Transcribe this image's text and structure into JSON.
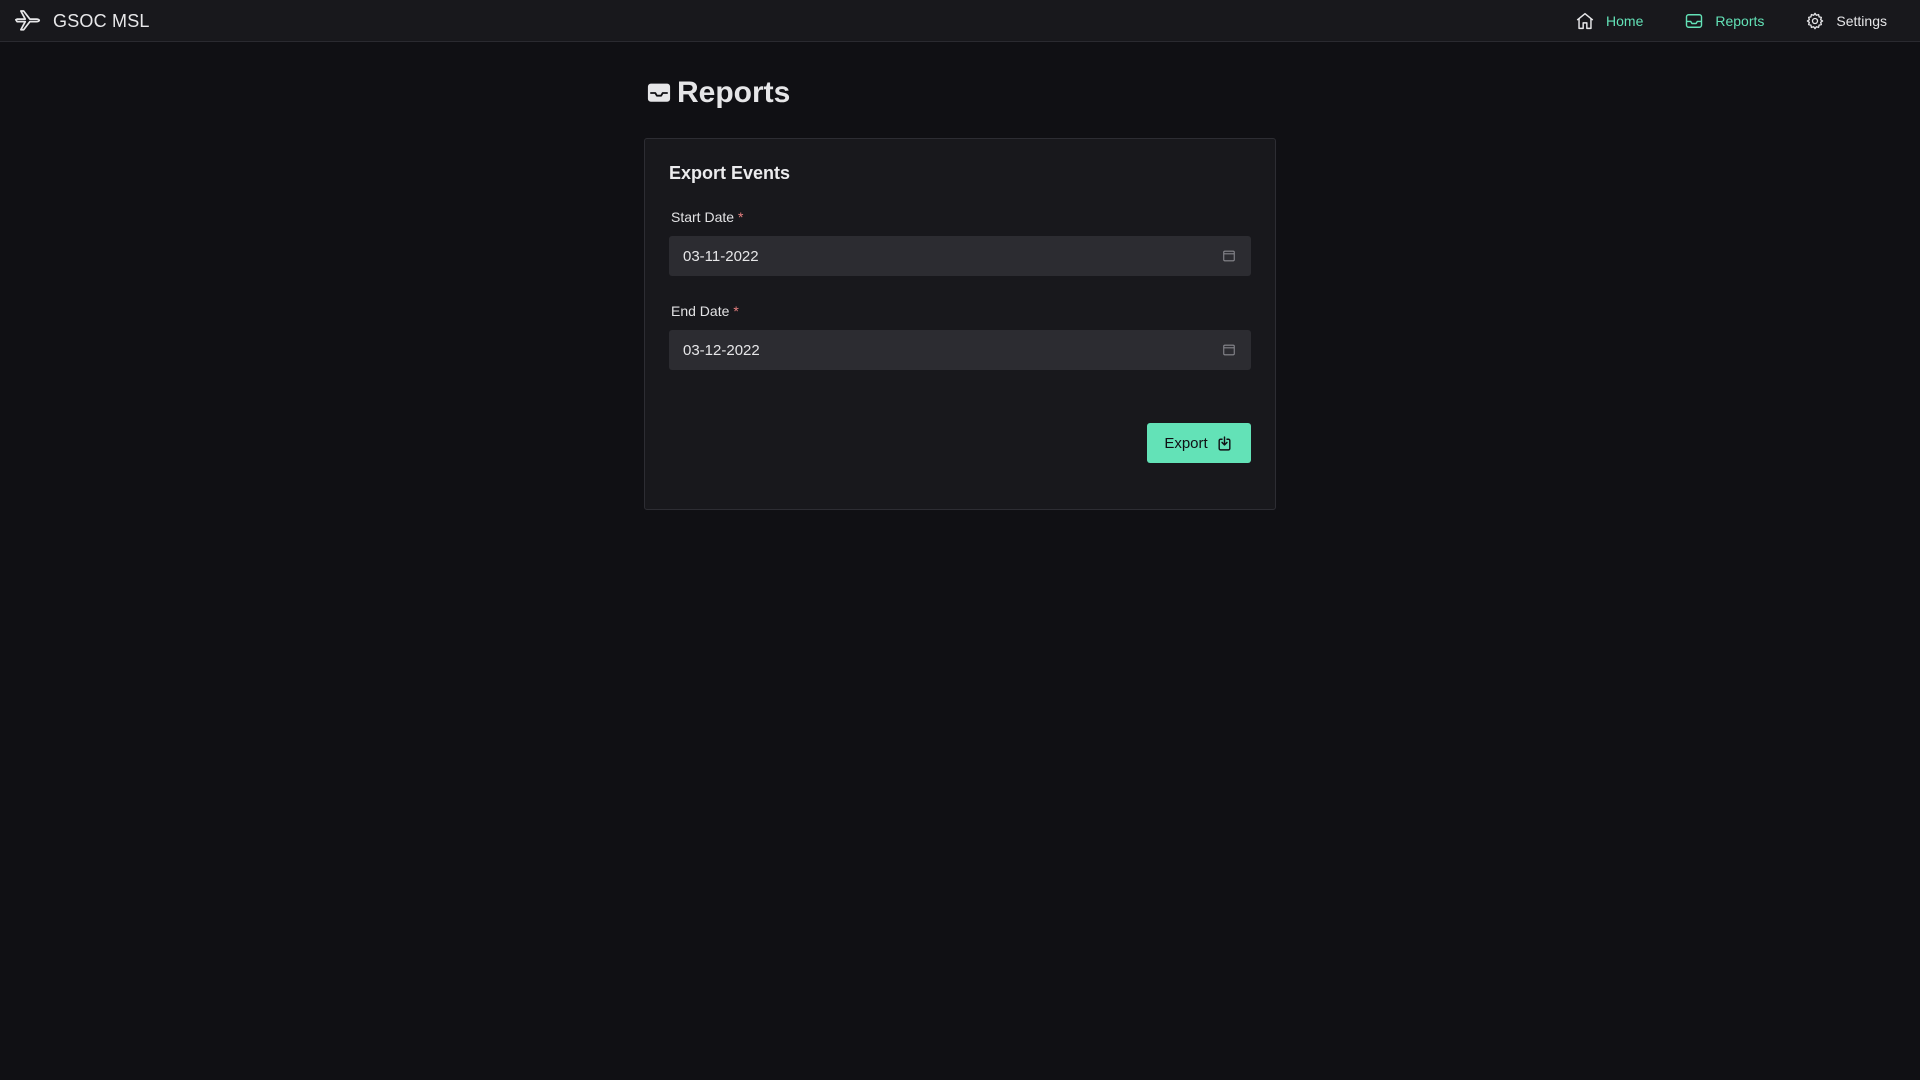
{
  "app": {
    "name": "GSOC MSL",
    "logo_icon": "airplane-icon"
  },
  "nav": {
    "items": [
      {
        "label": "Home",
        "icon": "home-icon",
        "color": "#63e2b7"
      },
      {
        "label": "Reports",
        "icon": "inbox-icon",
        "color": "#63e2b7"
      },
      {
        "label": "Settings",
        "icon": "gear-icon",
        "color": "#e6e6e8"
      }
    ]
  },
  "page": {
    "title": "Reports",
    "title_icon": "inbox-icon"
  },
  "form": {
    "title": "Export Events",
    "start_date": {
      "label": "Start Date",
      "required_mark": "*",
      "value": "03-11-2022",
      "icon": "calendar-icon"
    },
    "end_date": {
      "label": "End Date",
      "required_mark": "*",
      "value": "03-12-2022",
      "icon": "calendar-icon"
    },
    "export_button": {
      "label": "Export",
      "icon": "download-icon"
    }
  },
  "colors": {
    "accent": "#63e2b7",
    "background": "#101014",
    "card": "#18181c",
    "input": "#2c2c31",
    "required": "#e88080"
  }
}
